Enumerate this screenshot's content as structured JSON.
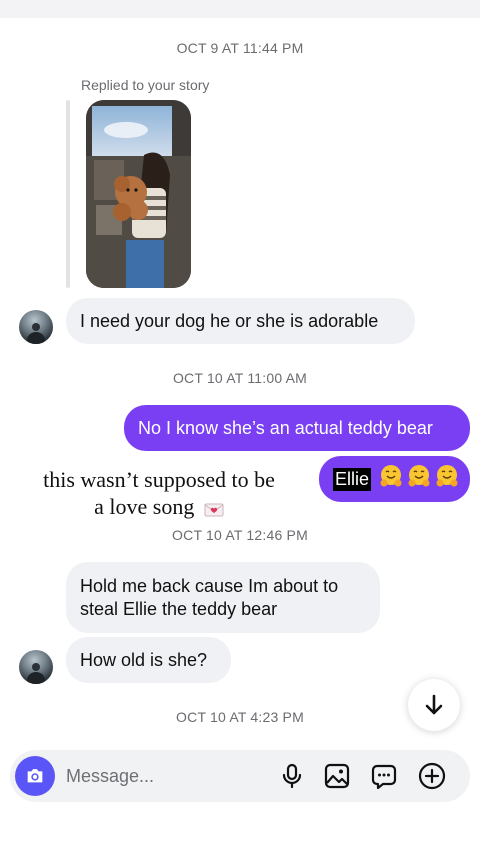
{
  "thread": {
    "timestamps": [
      "OCT 9 AT 11:44 PM",
      "OCT 10 AT 11:00 AM",
      "OCT 10 AT 12:46 PM",
      "OCT 10 AT 4:23 PM"
    ],
    "replied_label": "Replied to your story",
    "messages": {
      "in_1": "I need your dog he or she is adorable",
      "out_1": "No I know she’s an actual teddy bear",
      "out_2_name": "Ellie",
      "in_2_line1": "Hold me back cause Im about to",
      "in_2_line2": "steal Ellie the teddy bear",
      "in_3": "How old is she?"
    },
    "sticker": {
      "line1": "this wasn’t supposed to be",
      "line2": "a love song"
    }
  },
  "composer": {
    "placeholder": "Message...",
    "icons": [
      "camera-icon",
      "microphone-icon",
      "image-icon",
      "sticker-icon",
      "plus-circle-icon"
    ]
  },
  "scroll_button": {
    "icon": "arrow-down-icon"
  },
  "colors": {
    "outgoing_bubble": "#7a3ff2",
    "incoming_bubble": "#eff1f4",
    "camera_button": "#5a55f6",
    "timestamp": "#6b6b70"
  }
}
